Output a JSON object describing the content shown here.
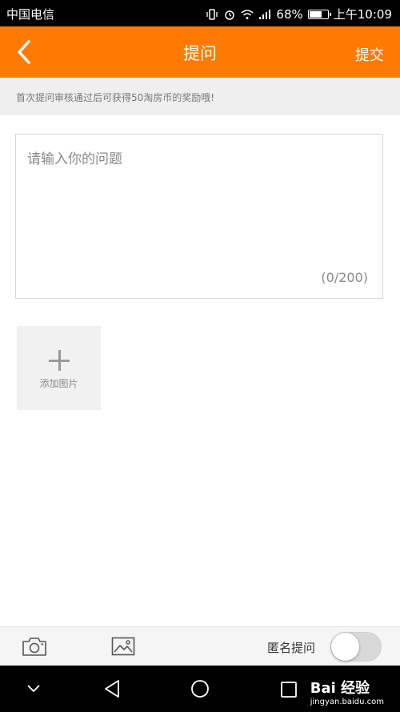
{
  "status_bar": {
    "carrier": "中国电信",
    "battery_percent": "68%",
    "time": "上午10:09",
    "icons": [
      "vibrate-icon",
      "alarm-icon",
      "wifi-icon",
      "signal-icon",
      "battery-icon"
    ]
  },
  "nav": {
    "title": "提问",
    "submit_label": "提交",
    "back_icon": "chevron-left-icon"
  },
  "notice": {
    "text": "首次提问审核通过后可获得50淘房币的奖励哦!"
  },
  "question": {
    "placeholder": "请输入你的问题",
    "value": "",
    "counter": "(0/200)"
  },
  "add_image": {
    "label": "添加图片",
    "icon": "plus-icon"
  },
  "bottom_bar": {
    "camera_icon": "camera-icon",
    "gallery_icon": "image-icon",
    "anonymous_label": "匿名提问",
    "anonymous_enabled": false
  },
  "system_nav": {
    "icons": [
      "chevron-down-icon",
      "back-triangle-icon",
      "home-circle-icon",
      "recents-square-icon"
    ],
    "watermark_main": "Bai 经验",
    "watermark_sub": "jingyan.baidu.com"
  },
  "colors": {
    "accent": "#ff7a00",
    "status_bar": "#000000",
    "notice_bg": "#efefef"
  }
}
